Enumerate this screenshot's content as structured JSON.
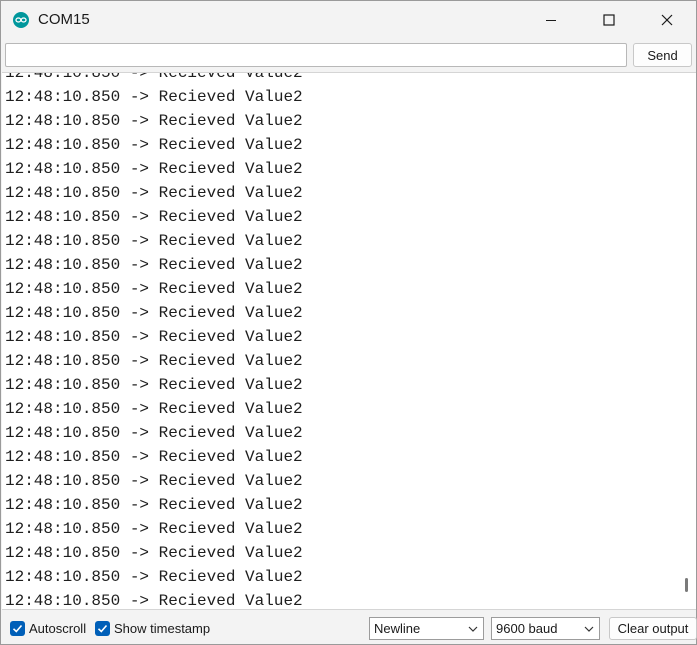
{
  "window": {
    "title": "COM15",
    "app_icon": "arduino-icon",
    "controls": [
      "minimize-icon",
      "maximize-icon",
      "close-icon"
    ]
  },
  "send_row": {
    "input_value": "",
    "send_label": "Send"
  },
  "output": {
    "lines": [
      "12:48:10.850 -> Recieved Value2",
      "12:48:10.850 -> Recieved Value2",
      "12:48:10.850 -> Recieved Value2",
      "12:48:10.850 -> Recieved Value2",
      "12:48:10.850 -> Recieved Value2",
      "12:48:10.850 -> Recieved Value2",
      "12:48:10.850 -> Recieved Value2",
      "12:48:10.850 -> Recieved Value2",
      "12:48:10.850 -> Recieved Value2",
      "12:48:10.850 -> Recieved Value2",
      "12:48:10.850 -> Recieved Value2",
      "12:48:10.850 -> Recieved Value2",
      "12:48:10.850 -> Recieved Value2",
      "12:48:10.850 -> Recieved Value2",
      "12:48:10.850 -> Recieved Value2",
      "12:48:10.850 -> Recieved Value2",
      "12:48:10.850 -> Recieved Value2",
      "12:48:10.850 -> Recieved Value2",
      "12:48:10.850 -> Recieved Value2",
      "12:48:10.850 -> Recieved Value2",
      "12:48:10.850 -> Recieved Value2",
      "12:48:10.850 -> Recieved Value2",
      "12:48:10.850 -> Recieved Value2"
    ]
  },
  "bottom": {
    "autoscroll_label": "Autoscroll",
    "autoscroll_checked": true,
    "timestamp_label": "Show timestamp",
    "timestamp_checked": true,
    "line_ending": "Newline",
    "baud_rate": "9600 baud",
    "clear_label": "Clear output"
  },
  "colors": {
    "accent": "#005fb8",
    "arduino_teal": "#00979c"
  }
}
